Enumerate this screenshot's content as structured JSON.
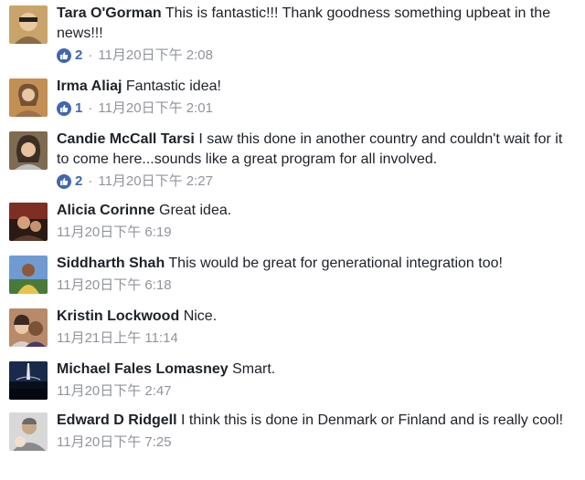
{
  "comments": [
    {
      "author": "Tara O'Gorman",
      "text": "This is fantastic!!! Thank goodness something upbeat in the news!!!",
      "likes": "2",
      "time": "11月20日下午 2:08",
      "avatar_colors": [
        "#c9a46a",
        "#8a6a48"
      ]
    },
    {
      "author": "Irma Aliaj",
      "text": "Fantastic idea!",
      "likes": "1",
      "time": "11月20日下午 2:01",
      "avatar_colors": [
        "#c38f53",
        "#6b4a2f"
      ]
    },
    {
      "author": "Candie McCall Tarsi",
      "text": "I saw this done in another country and couldn't wait for it to come here...sounds like a great program for all involved.",
      "likes": "2",
      "time": "11月20日下午 2:27",
      "avatar_colors": [
        "#7f6b52",
        "#3b2f24"
      ]
    },
    {
      "author": "Alicia Corinne",
      "text": "Great idea.",
      "likes": "",
      "time": "11月20日下午 6:19",
      "avatar_colors": [
        "#7d2f24",
        "#2a1a14"
      ]
    },
    {
      "author": "Siddharth Shah",
      "text": "This would be great for generational integration too!",
      "likes": "",
      "time": "11月20日下午 6:18",
      "avatar_colors": [
        "#6f9bd1",
        "#e6c34a"
      ]
    },
    {
      "author": "Kristin Lockwood",
      "text": "Nice.",
      "likes": "",
      "time": "11月21日上午 11:14",
      "avatar_colors": [
        "#b88a6a",
        "#3a2a22"
      ]
    },
    {
      "author": "Michael Fales Lomasney",
      "text": "Smart.",
      "likes": "",
      "time": "11月20日下午 2:47",
      "avatar_colors": [
        "#1a2a4a",
        "#0a0f1c"
      ]
    },
    {
      "author": "Edward D Ridgell",
      "text": "I think this is done in Denmark or Finland and is really cool!",
      "likes": "",
      "time": "11月20日下午 7:25",
      "avatar_colors": [
        "#d8d8d8",
        "#8a8a8a"
      ]
    }
  ]
}
